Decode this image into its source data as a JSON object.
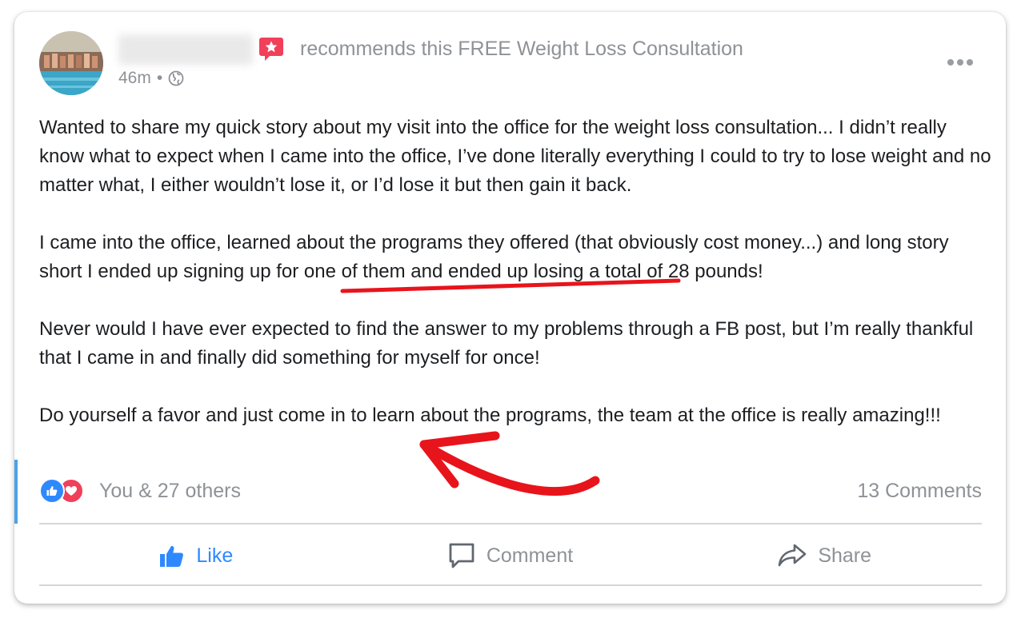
{
  "post": {
    "author_name": "",
    "recommendation_text": "recommends this FREE Weight Loss Consultation",
    "timestamp": "46m",
    "separator": "•",
    "privacy_icon": "globe-icon",
    "menu_icon": "more-horizontal-icon",
    "paragraphs": [
      "Wanted to share my quick story about my visit into the office for the weight loss consultation...  I didn’t really know what to expect when I came into the office, I’ve done literally everything I could to try to lose weight and no matter what, I either wouldn’t lose it, or I’d lose it but then gain it back.",
      "I came into the office, learned about the programs they offered (that obviously cost money...) and long story short I ended up signing up for one of them and ended up losing a total of 28 pounds!",
      "Never would I have ever expected to find the answer to my problems through a FB post, but I’m really thankful that I came in and finally did something for myself for once!",
      "Do yourself a favor and just come in to learn about the programs, the team at the office is really amazing!!!"
    ]
  },
  "reactions": {
    "icons": [
      "like-reaction-icon",
      "love-reaction-icon"
    ],
    "count_text": "You & 27 others",
    "comments_text": "13 Comments"
  },
  "actions": {
    "like_label": "Like",
    "comment_label": "Comment",
    "share_label": "Share"
  },
  "colors": {
    "like_blue": "#2e89ff",
    "love_red": "#f0405a",
    "badge_red": "#f0405a",
    "annotation_red": "#e8141c",
    "muted_text": "#8e9297",
    "body_text": "#1c1e21",
    "accent_bar": "#4aa3e8"
  },
  "annotations": [
    "red-underline-annotation",
    "red-arrow-annotation"
  ]
}
